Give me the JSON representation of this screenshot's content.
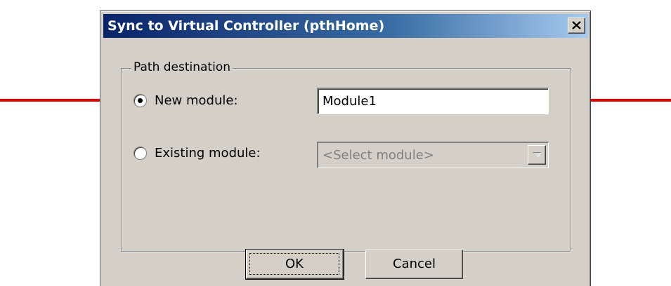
{
  "window": {
    "title": "Sync to Virtual Controller (pthHome)",
    "close_icon": "close-x-icon"
  },
  "group": {
    "label": "Path destination"
  },
  "options": [
    {
      "label": "New module:",
      "selected": true,
      "value": "Module1"
    },
    {
      "label": "Existing module:",
      "selected": false,
      "placeholder": "<Select module>",
      "disabled": true
    }
  ],
  "buttons": {
    "ok_label": "OK",
    "cancel_label": "Cancel"
  },
  "annotations": {
    "arrow_color": "#e00000",
    "arrow_icon": "red-arrow-icon"
  },
  "colors": {
    "dialog_bg": "#d4d0c8",
    "title_start": "#0a246a",
    "title_end": "#a6caf0"
  }
}
